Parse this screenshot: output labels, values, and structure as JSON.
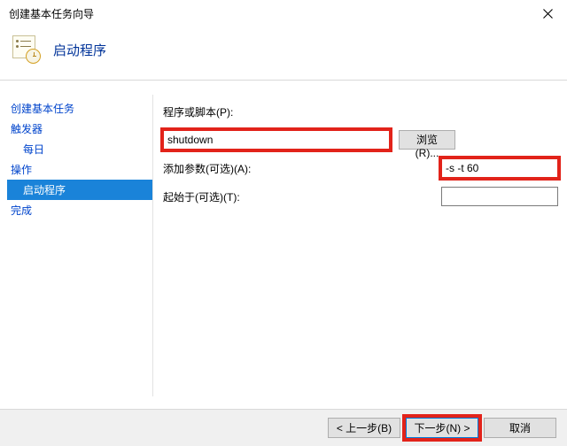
{
  "window": {
    "title": "创建基本任务向导"
  },
  "header": {
    "title": "启动程序"
  },
  "sidebar": {
    "create": "创建基本任务",
    "trigger": "触发器",
    "daily": "每日",
    "action": "操作",
    "start_program": "启动程序",
    "finish": "完成"
  },
  "form": {
    "program_label": "程序或脚本(P):",
    "program_value": "shutdown",
    "browse_label": "浏览(R)...",
    "args_label": "添加参数(可选)(A):",
    "args_value": "-s -t 60",
    "startin_label": "起始于(可选)(T):",
    "startin_value": ""
  },
  "footer": {
    "back": "< 上一步(B)",
    "next": "下一步(N) >",
    "cancel": "取消"
  }
}
